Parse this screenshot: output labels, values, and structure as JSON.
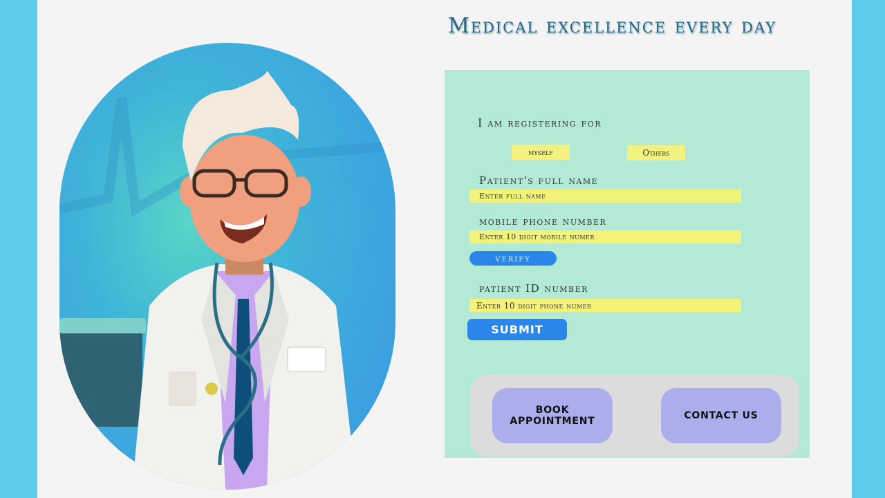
{
  "header": {
    "title": "Medical excellence every day"
  },
  "form": {
    "registering_label": "I am registering for",
    "options": [
      "myself",
      "Others"
    ],
    "full_name": {
      "label": "Patient's full name",
      "placeholder": "Enter full name"
    },
    "mobile": {
      "label": "mobile phone number",
      "placeholder": "Enter 10 digit mobile numer"
    },
    "verify_label": "verify",
    "patient_id": {
      "label": "patient ID number",
      "placeholder": "Enter 10 digit phone numer"
    },
    "submit_label": "SUBMIT"
  },
  "actions": {
    "book_label": "BOOK APPOINTMENT",
    "contact_label": "CONTACT US"
  },
  "colors": {
    "side_band": "#5ecbe8",
    "page_bg": "#f4f4f4",
    "panel_bg": "#b3ead6",
    "field_bg": "#f3f37a",
    "primary_button": "#2a86e8",
    "action_button": "#abaeec",
    "title": "#1a6b8c"
  },
  "illustration": {
    "name": "doctor-illustration"
  }
}
